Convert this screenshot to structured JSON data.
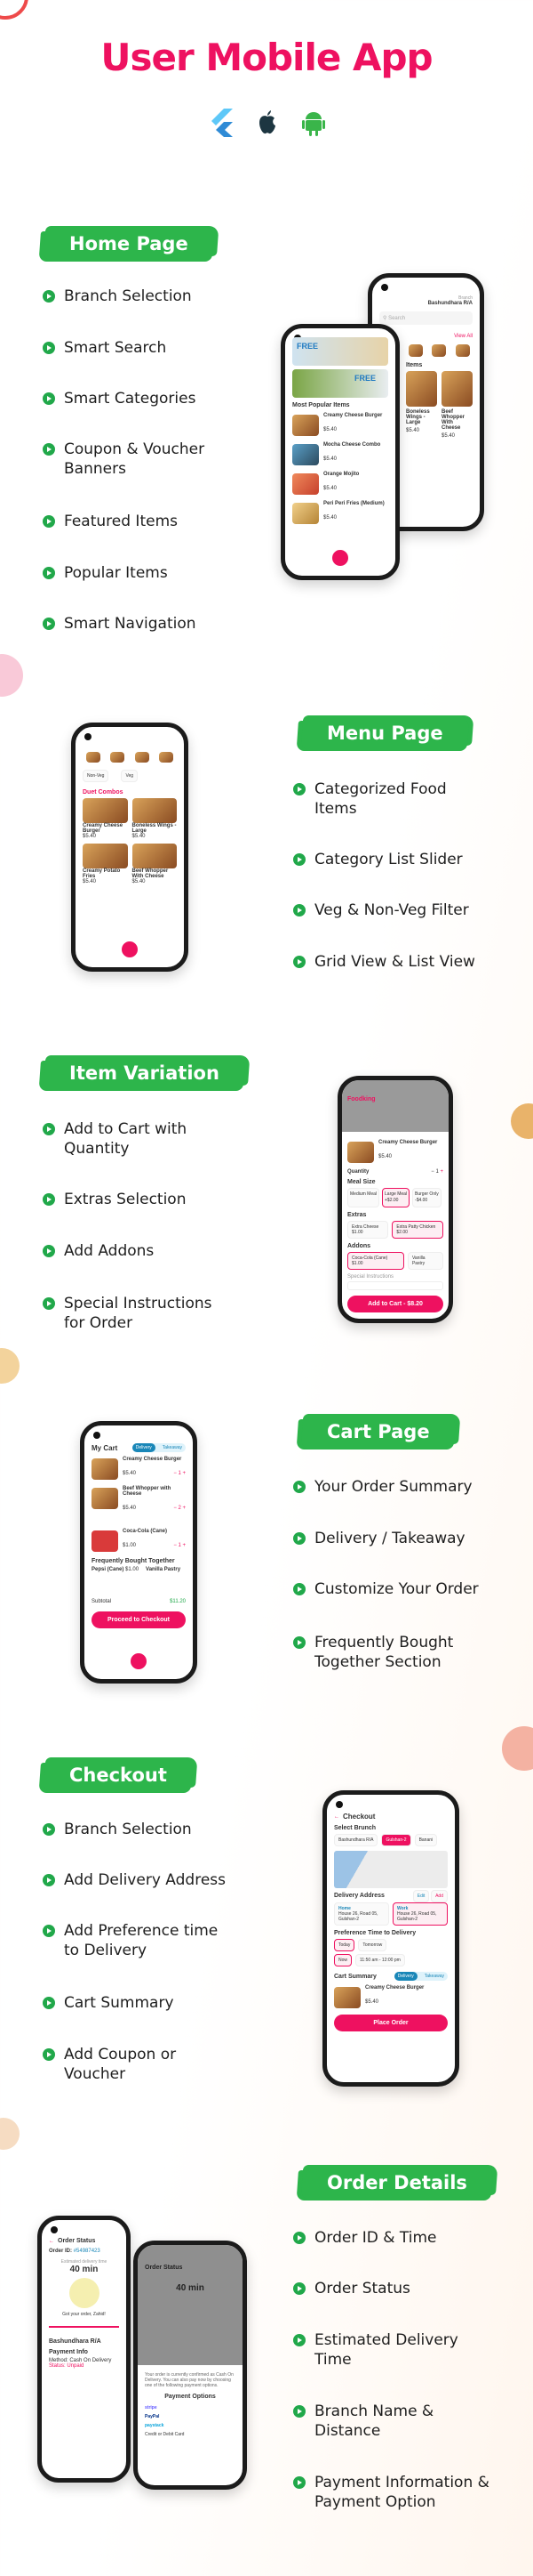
{
  "title": "User Mobile App",
  "platforms": [
    "flutter-icon",
    "apple-icon",
    "android-icon"
  ],
  "colors": {
    "brand": "#ee1160",
    "accent": "#2db54b"
  },
  "sections": {
    "home": {
      "badge": "Home Page",
      "bullets": [
        "Branch Selection",
        "Smart Search",
        "Smart Categories",
        "Coupon & Voucher Banners",
        "Featured Items",
        "Popular Items",
        "Smart Navigation"
      ],
      "phone_front": {
        "banner1": "FREE",
        "banner2": "FREE",
        "popular_title": "Most Popular Items",
        "items": [
          {
            "name": "Creamy Cheese Burger",
            "price": "$5.40"
          },
          {
            "name": "Mocha Cheese Combo",
            "price": "$5.40"
          },
          {
            "name": "Orange Mojito",
            "price": "$5.40"
          },
          {
            "name": "Peri Peri Fries (Medium)",
            "price": "$5.40"
          }
        ]
      },
      "phone_back": {
        "branch_label": "Branch",
        "branch": "Bashundhara R/A",
        "search_placeholder": "Search",
        "view_all": "View All",
        "items_title": "Items",
        "items": [
          {
            "name": "Boneless Wings - Large",
            "price": "$5.40"
          },
          {
            "name": "Beef Whopper With Cheese",
            "price": "$5.40"
          }
        ]
      }
    },
    "menu": {
      "badge": "Menu Page",
      "bullets": [
        "Categorized Food Items",
        "Category List Slider",
        "Veg & Non-Veg Filter",
        "Grid View & List View"
      ],
      "phone": {
        "filters": [
          "Non-Veg",
          "Veg"
        ],
        "section": "Duet Combos",
        "items": [
          {
            "name": "Creamy Cheese Burger",
            "price": "$5.40"
          },
          {
            "name": "Boneless Wings - Large",
            "price": "$5.40"
          },
          {
            "name": "Creamy Potato Fries",
            "price": "$5.40"
          },
          {
            "name": "Beef Whopper With Cheese",
            "price": "$5.40"
          }
        ]
      }
    },
    "variation": {
      "badge": "Item Variation",
      "bullets": [
        "Add to Cart with Quantity",
        "Extras Selection",
        "Add Addons",
        "Special Instructions for Order"
      ],
      "phone": {
        "brand": "Foodking",
        "item": "Creamy Cheese Burger",
        "price": "$5.40",
        "quantity_label": "Quantity",
        "quantity": "1",
        "meal_size": "Meal Size",
        "sizes": [
          {
            "name": "Medium Meal",
            "price": ""
          },
          {
            "name": "Large Meal",
            "price": "+$2.00"
          },
          {
            "name": "Burger Only",
            "price": "-$4.00"
          }
        ],
        "extras_label": "Extras",
        "extras": [
          {
            "name": "Extra Cheese",
            "price": "$1.00"
          },
          {
            "name": "Extra Patty Chicken",
            "price": "$2.00"
          }
        ],
        "addons_label": "Addons",
        "addons": [
          {
            "name": "Coca-Cola (Cane)",
            "price": "$1.00"
          },
          {
            "name": "Vanilla Pastry",
            "price": "$1.00"
          }
        ],
        "instructions_label": "Special Instructions",
        "add_button": "Add to Cart - $8.20"
      }
    },
    "cart": {
      "badge": "Cart Page",
      "bullets": [
        "Your Order Summary",
        "Delivery / Takeaway",
        "Customize Your Order",
        "Frequently Bought Together Section"
      ],
      "phone": {
        "title": "My Cart",
        "modes": [
          "Delivery",
          "Takeaway"
        ],
        "items": [
          {
            "name": "Creamy Cheese Burger",
            "price": "$5.40",
            "qty": "1"
          },
          {
            "name": "Beef Whopper with Cheese",
            "price": "$5.40",
            "qty": "2"
          },
          {
            "name": "Coca-Cola (Cane)",
            "price": "$1.00",
            "qty": "1"
          }
        ],
        "fbt_title": "Frequently Bought Together",
        "fbt": [
          {
            "name": "Pepsi (Cane)",
            "price": "$1.00"
          },
          {
            "name": "Vanilla Pastry",
            "price": "$1.00"
          }
        ],
        "subtotal_label": "Subtotal",
        "subtotal": "$11.20",
        "checkout_button": "Proceed to Checkout"
      }
    },
    "checkout": {
      "badge": "Checkout",
      "bullets": [
        "Branch Selection",
        "Add Delivery Address",
        "Add Preference time to Delivery",
        "Cart Summary",
        "Add Coupon or Voucher"
      ],
      "phone": {
        "title": "Checkout",
        "branch_title": "Select Brunch",
        "branches": [
          "Bashundhara R/A",
          "Gulshan-2",
          "Banani"
        ],
        "address_title": "Delivery Address",
        "edit": "Edit",
        "add": "Add",
        "addresses": [
          {
            "label": "Home",
            "text": "House 26, Road 05, Gulshan-2"
          },
          {
            "label": "Work",
            "text": "House 26, Road 05, Gulshan-2"
          }
        ],
        "pref_title": "Preference Time to Delivery",
        "days": [
          "Today",
          "Tomorrow"
        ],
        "times": [
          "Now",
          "11:50 am - 12:00 pm"
        ],
        "summary_title": "Cart Summary",
        "modes": [
          "Delivery",
          "Takeaway"
        ],
        "item": "Creamy Cheese Burger",
        "item_price": "$5.40",
        "place_button": "Place Order"
      }
    },
    "order": {
      "badge": "Order Details",
      "bullets": [
        "Order ID & Time",
        "Order Status",
        "Estimated Delivery Time",
        "Branch Name & Distance",
        "Payment Information & Payment Option"
      ],
      "phone": {
        "title": "Order Status",
        "order_id_label": "Order ID:",
        "order_id": "#54987423",
        "eta_label": "Estimated delivery time",
        "eta": "40 min",
        "got_order": "Got your order, Zahid!",
        "branch": "Bashundhara R/A",
        "payment_title": "Payment Info",
        "method": "Method: Cash On Delivery",
        "status": "Status: Unpaid",
        "payment_note": "Your order is currently confirmed as Cash On Delivery. You can also pay now by choosing one of the following payment options.",
        "payment_options": "Payment Options",
        "providers": [
          "stripe",
          "PayPal",
          "paystack",
          "Credit or Debit Card"
        ]
      }
    }
  }
}
